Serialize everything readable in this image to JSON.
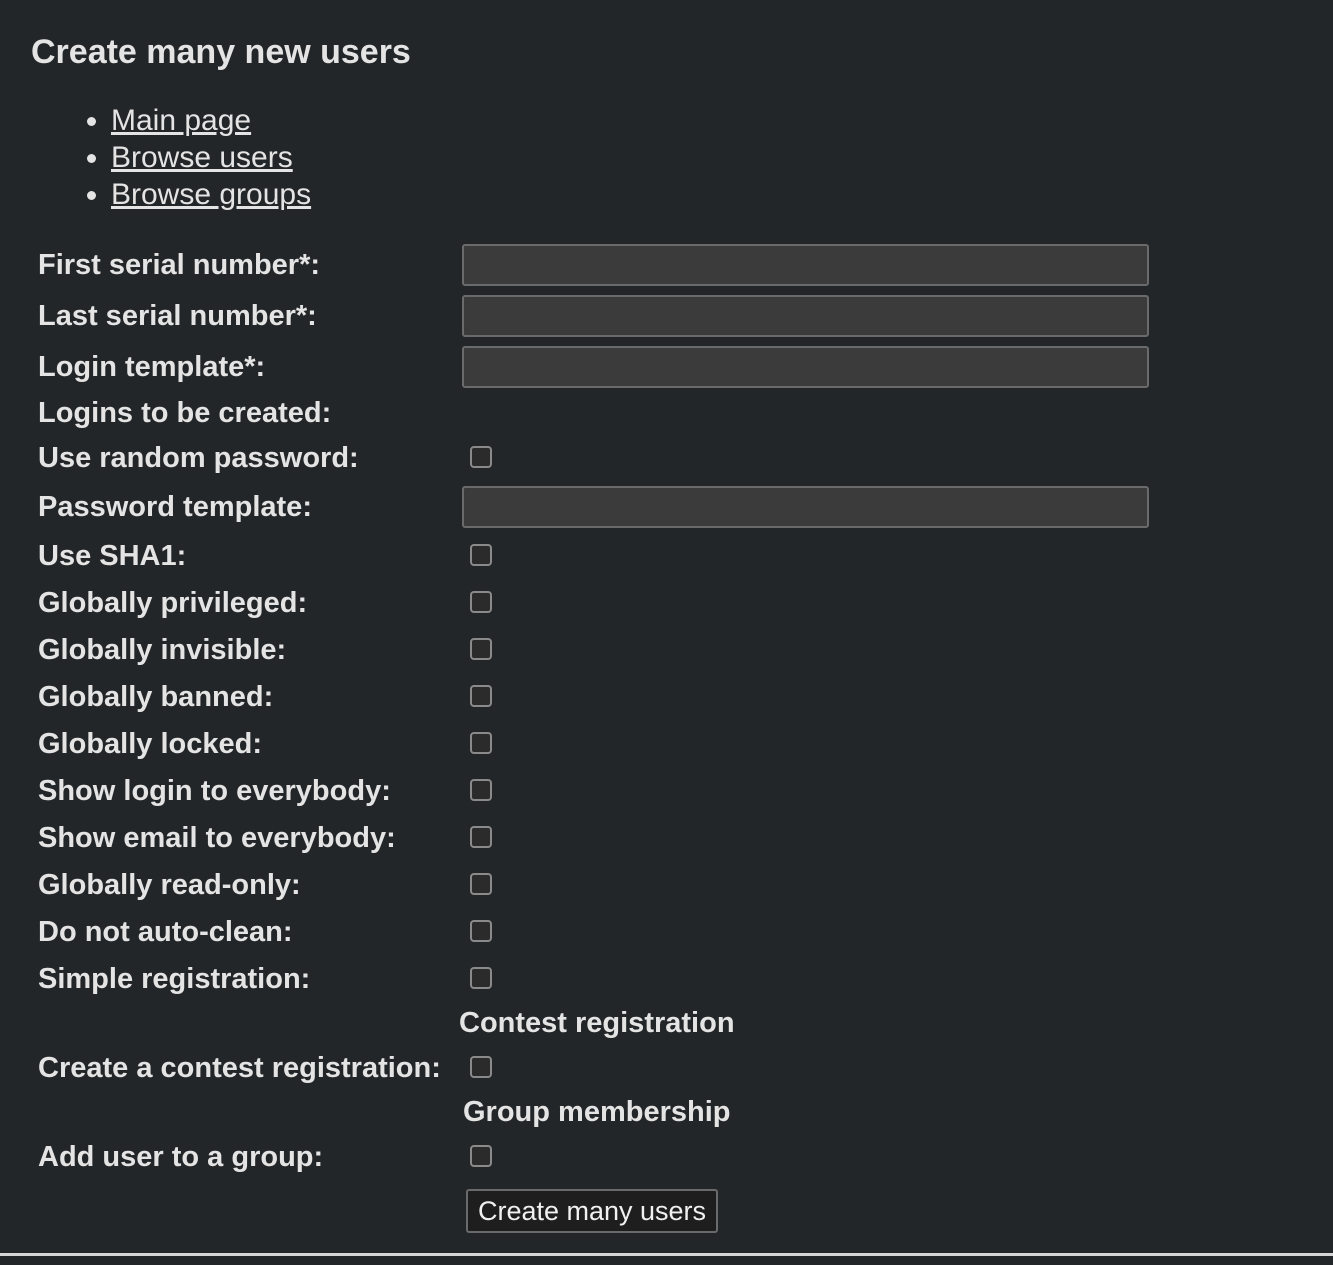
{
  "page": {
    "title": "Create many new users"
  },
  "nav": {
    "items": [
      {
        "label": "Main page"
      },
      {
        "label": "Browse users"
      },
      {
        "label": "Browse groups"
      }
    ]
  },
  "form": {
    "first_serial": {
      "label": "First serial number*:",
      "value": ""
    },
    "last_serial": {
      "label": "Last serial number*:",
      "value": ""
    },
    "login_template": {
      "label": "Login template*:",
      "value": ""
    },
    "logins_to_be_created": {
      "label": "Logins to be created:"
    },
    "use_random_password": {
      "label": "Use random password:",
      "checked": false
    },
    "password_template": {
      "label": "Password template:",
      "value": ""
    },
    "use_sha1": {
      "label": "Use SHA1:",
      "checked": false
    },
    "globally_privileged": {
      "label": "Globally privileged:",
      "checked": false
    },
    "globally_invisible": {
      "label": "Globally invisible:",
      "checked": false
    },
    "globally_banned": {
      "label": "Globally banned:",
      "checked": false
    },
    "globally_locked": {
      "label": "Globally locked:",
      "checked": false
    },
    "show_login": {
      "label": "Show login to everybody:",
      "checked": false
    },
    "show_email": {
      "label": "Show email to everybody:",
      "checked": false
    },
    "globally_read_only": {
      "label": "Globally read-only:",
      "checked": false
    },
    "do_not_auto_clean": {
      "label": "Do not auto-clean:",
      "checked": false
    },
    "simple_registration": {
      "label": "Simple registration:",
      "checked": false
    },
    "contest_registration_heading": "Contest registration",
    "create_contest_registration": {
      "label": "Create a contest registration:",
      "checked": false
    },
    "group_membership_heading": "Group membership",
    "add_user_to_group": {
      "label": "Add user to a group:",
      "checked": false
    },
    "submit_label": "Create many users"
  },
  "colors": {
    "background": "#232628",
    "text": "#e4e4e4",
    "input_bg": "#3b3b3b",
    "input_border": "#6a6a6a"
  }
}
